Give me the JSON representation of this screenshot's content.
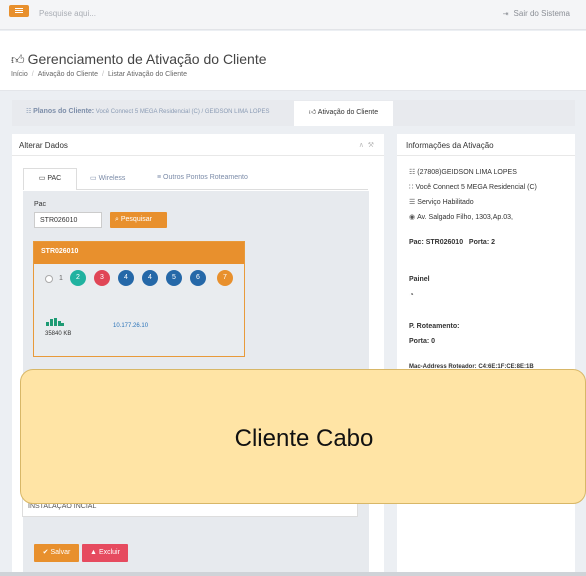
{
  "topbar": {
    "search_placeholder": "Pesquise aqui...",
    "logout_label": "Sair do Sistema"
  },
  "header": {
    "title": "Gerenciamento de Ativação do Cliente",
    "breadcrumb": [
      "Início",
      "Ativação do Cliente",
      "Listar Ativação do Cliente"
    ]
  },
  "tabs": {
    "planos_label": "Planos do Cliente:",
    "planos_detail": "Você Connect 5 MEGA Residencial (C) / GEIDSON LIMA LOPES",
    "ativacao_label": "Ativação do Cliente"
  },
  "left_panel": {
    "title": "Alterar Dados",
    "inner_tabs": [
      "PAC",
      "Wireless",
      "Outros Pontos Roteamento"
    ],
    "pac_label": "Pac",
    "pac_value": "STR026010",
    "search_button": "Pesquisar",
    "card": {
      "title": "STR026010",
      "radio_number": "1",
      "ports": [
        "2",
        "3",
        "4",
        "4",
        "5",
        "6",
        "7"
      ],
      "traffic": "35840 KB",
      "ip": "10.177.26.10"
    },
    "observation": "INSTALAÇÃO INCIAL",
    "save_button": "Salvar",
    "delete_button": "Excluir"
  },
  "right_panel": {
    "title": "Informações da Ativação",
    "client": "(27808)GEIDSON LIMA LOPES",
    "plan": "Você Connect 5 MEGA Residencial (C)",
    "service": "Serviço Habilitado",
    "address": "Av. Salgado Filho, 1303,Ap.03,",
    "pac_line": "Pac: STR026010   Porta: 2",
    "painel": "Painel",
    "roteamento": "P. Roteamento:",
    "porta": "Porta: 0",
    "mac": "Mac-Address Roteador: C4:6E:1F:CE:8E:1B"
  },
  "tooltip": {
    "text": "Cliente Cabo"
  },
  "colors": {
    "accent": "#e8902d",
    "danger": "#e64b5f",
    "teal": "#20b2a0",
    "red": "#e04656",
    "blue": "#2568a8",
    "orange": "#e8902d",
    "tooltip_bg": "#ffe4a5"
  },
  "icons": {
    "menu": "hamburger-icon",
    "logout": "logout-icon",
    "thumbs_up": "thumbs-up-icon",
    "wifi": "wifi-icon",
    "signal": "signal-icon"
  }
}
